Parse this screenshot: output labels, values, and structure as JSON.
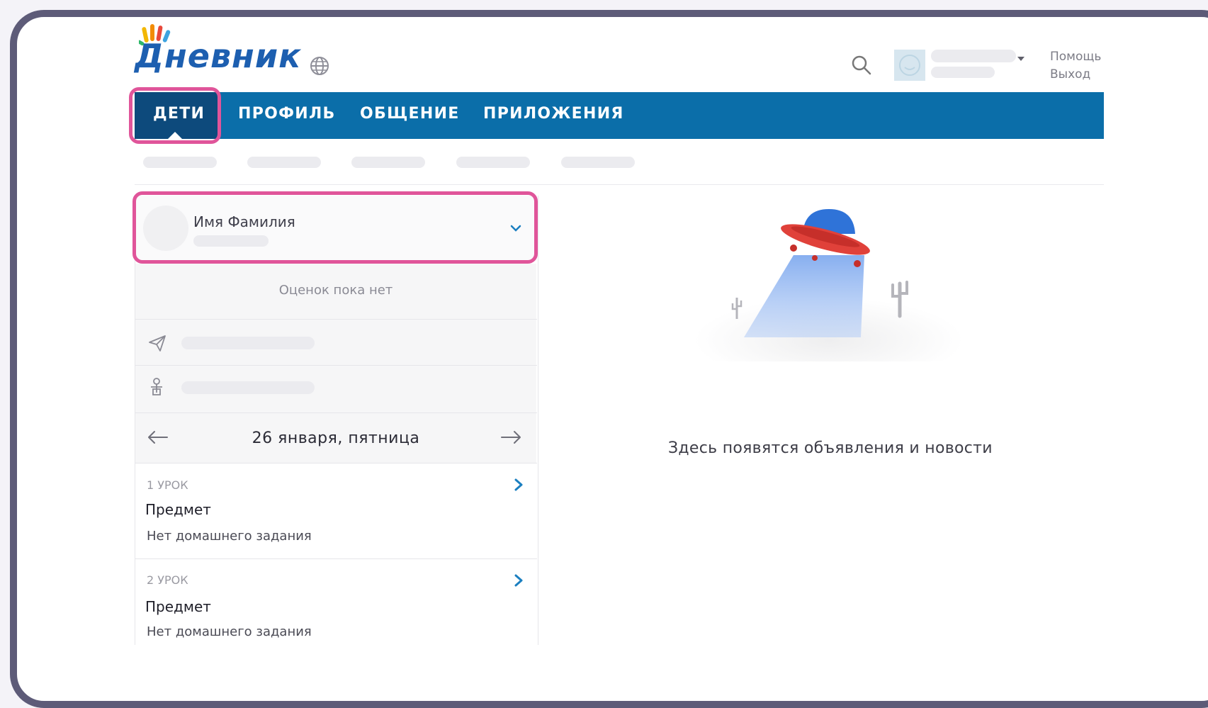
{
  "app": {
    "logo_text": "Дневник"
  },
  "header": {
    "help_label": "Помощь",
    "logout_label": "Выход"
  },
  "nav": {
    "items": [
      "ДЕТИ",
      "ПРОФИЛЬ",
      "ОБЩЕНИЕ",
      "ПРИЛОЖЕНИЯ"
    ],
    "active": "ДЕТИ"
  },
  "child": {
    "name": "Имя Фамилия",
    "no_grades": "Оценок пока нет"
  },
  "schedule": {
    "date": "26 января, пятница",
    "lessons": [
      {
        "number": "1 УРОК",
        "subject": "Предмет",
        "homework": "Нет домашнего задания"
      },
      {
        "number": "2 УРОК",
        "subject": "Предмет",
        "homework": "Нет домашнего задания"
      }
    ]
  },
  "feed": {
    "empty_message": "Здесь появятся объявления и новости"
  },
  "colors": {
    "nav_bg": "#0b6ea9",
    "nav_active": "#0d4a7c",
    "highlight": "#e0559a",
    "link_accent": "#1b7fc0"
  },
  "icons": [
    "globe-icon",
    "search-icon",
    "chevron-down-icon",
    "paper-plane-icon",
    "person-icon",
    "arrow-left-icon",
    "arrow-right-icon",
    "chevron-right-icon",
    "ufo-illustration"
  ]
}
